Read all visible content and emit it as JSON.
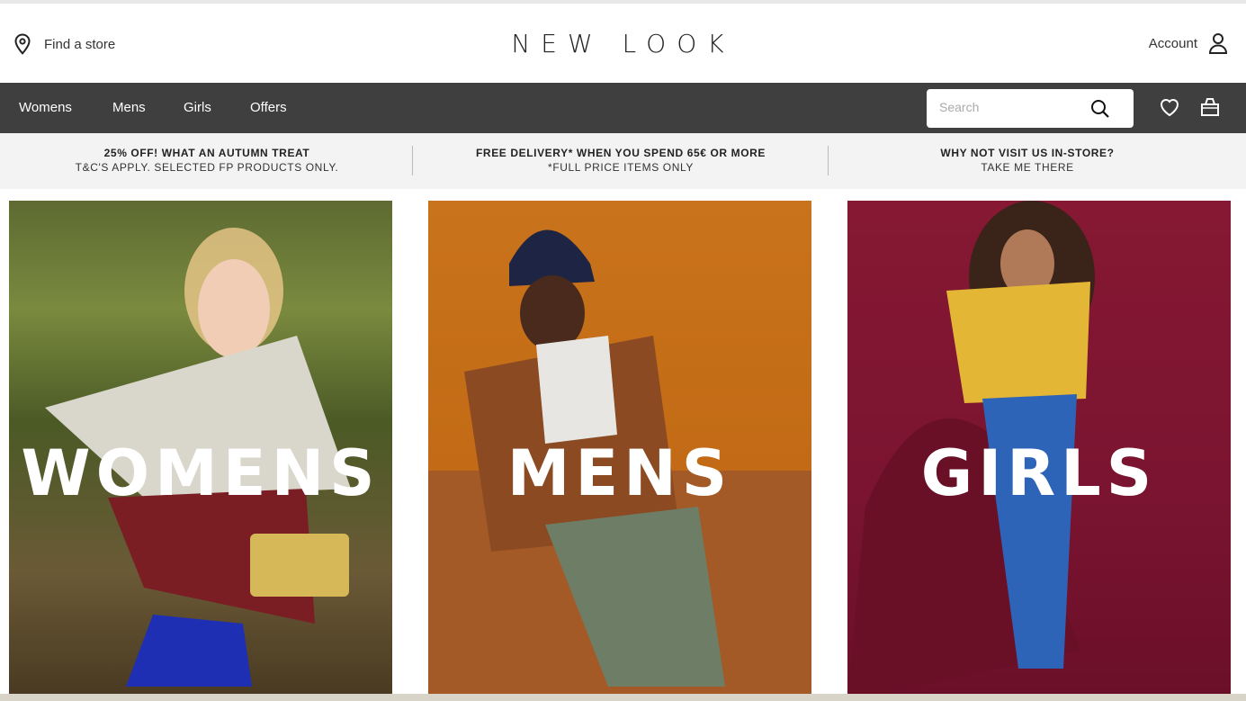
{
  "header": {
    "find_store_label": "Find a store",
    "logo_text": "NEW LOOK",
    "account_label": "Account"
  },
  "nav": {
    "items": [
      {
        "label": "Womens"
      },
      {
        "label": "Mens"
      },
      {
        "label": "Girls"
      },
      {
        "label": "Offers"
      }
    ],
    "search_placeholder": "Search",
    "icons": [
      "search-icon",
      "heart-icon",
      "bag-icon"
    ]
  },
  "promo": [
    {
      "title": "25% OFF! WHAT AN AUTUMN TREAT",
      "subtitle": "T&C'S APPLY. SELECTED FP PRODUCTS ONLY."
    },
    {
      "title": "FREE DELIVERY* WHEN YOU SPEND 65€ OR MORE",
      "subtitle": "*FULL PRICE ITEMS ONLY"
    },
    {
      "title": "WHY NOT VISIT US IN-STORE?",
      "subtitle": "TAKE ME THERE"
    }
  ],
  "tiles": [
    {
      "label": "WOMENS"
    },
    {
      "label": "MENS"
    },
    {
      "label": "GIRLS"
    }
  ],
  "colors": {
    "nav_bg": "#3f3f3f",
    "promo_bg": "#f3f3f3",
    "womens_tile": "#5e6a32",
    "mens_tile": "#c9731c",
    "girls_tile": "#861833"
  }
}
